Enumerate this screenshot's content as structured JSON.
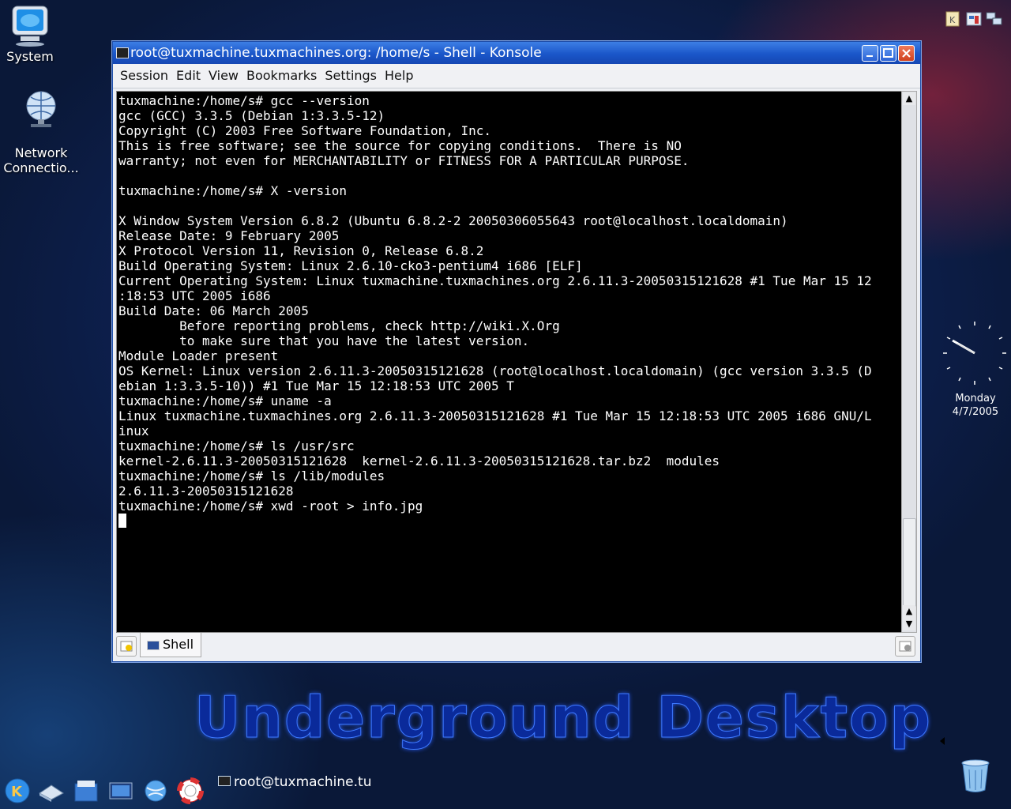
{
  "desktop": {
    "icons": [
      {
        "label": "System"
      },
      {
        "label": "Network\nConnectio..."
      }
    ],
    "branding": "Underground Desktop"
  },
  "window": {
    "title": "root@tuxmachine.tuxmachines.org: /home/s - Shell - Konsole",
    "menu": [
      "Session",
      "Edit",
      "View",
      "Bookmarks",
      "Settings",
      "Help"
    ],
    "terminal_text": "tuxmachine:/home/s# gcc --version\ngcc (GCC) 3.3.5 (Debian 1:3.3.5-12)\nCopyright (C) 2003 Free Software Foundation, Inc.\nThis is free software; see the source for copying conditions.  There is NO\nwarranty; not even for MERCHANTABILITY or FITNESS FOR A PARTICULAR PURPOSE.\n\ntuxmachine:/home/s# X -version\n\nX Window System Version 6.8.2 (Ubuntu 6.8.2-2 20050306055643 root@localhost.localdomain)\nRelease Date: 9 February 2005\nX Protocol Version 11, Revision 0, Release 6.8.2\nBuild Operating System: Linux 2.6.10-cko3-pentium4 i686 [ELF]\nCurrent Operating System: Linux tuxmachine.tuxmachines.org 2.6.11.3-20050315121628 #1 Tue Mar 15 12\n:18:53 UTC 2005 i686\nBuild Date: 06 March 2005\n        Before reporting problems, check http://wiki.X.Org\n        to make sure that you have the latest version.\nModule Loader present\nOS Kernel: Linux version 2.6.11.3-20050315121628 (root@localhost.localdomain) (gcc version 3.3.5 (D\nebian 1:3.3.5-10)) #1 Tue Mar 15 12:18:53 UTC 2005 T\ntuxmachine:/home/s# uname -a\nLinux tuxmachine.tuxmachines.org 2.6.11.3-20050315121628 #1 Tue Mar 15 12:18:53 UTC 2005 i686 GNU/L\ninux\ntuxmachine:/home/s# ls /usr/src\nkernel-2.6.11.3-20050315121628  kernel-2.6.11.3-20050315121628.tar.bz2  modules\ntuxmachine:/home/s# ls /lib/modules\n2.6.11.3-20050315121628\ntuxmachine:/home/s# xwd -root > info.jpg",
    "tab_label": "Shell"
  },
  "clock": {
    "day": "Monday",
    "date": "4/7/2005"
  },
  "taskbar": {
    "launchers": [
      "kmenu-icon",
      "home-folder-icon",
      "konqueror-icon",
      "konsole-icon",
      "web-browser-icon",
      "help-icon"
    ],
    "task_label": "root@tuxmachine.tu"
  },
  "colors": {
    "titlebar": "#1a56c9",
    "terminal_bg": "#000000",
    "terminal_fg": "#ffffff",
    "brand_text": "#0a2a9a"
  }
}
